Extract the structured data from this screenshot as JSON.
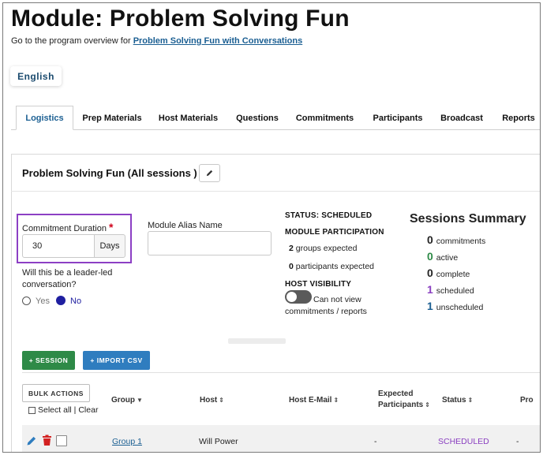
{
  "page": {
    "title": "Module: Problem Solving Fun",
    "overview_prefix": "Go to the program overview for ",
    "overview_link": "Problem Solving Fun with Conversations"
  },
  "language": {
    "label": "English"
  },
  "tabs": [
    {
      "label": "Logistics",
      "active": true
    },
    {
      "label": "Prep Materials"
    },
    {
      "label": "Host Materials"
    },
    {
      "label": "Questions"
    },
    {
      "label": "Commitments"
    },
    {
      "label": "Participants"
    },
    {
      "label": "Broadcast"
    },
    {
      "label": "Reports"
    }
  ],
  "panel": {
    "title": "Problem Solving Fun (All sessions )",
    "commitment_duration": {
      "label": "Commitment Duration",
      "required_mark": "*",
      "value": "30",
      "unit": "Days"
    },
    "alias": {
      "label": "Module Alias Name",
      "value": ""
    },
    "leader_led": {
      "question": "Will this be a leader-led conversation?",
      "yes_label": "Yes",
      "no_label": "No",
      "selected": "No"
    },
    "status": {
      "heading": "STATUS: SCHEDULED",
      "participation_heading": "MODULE PARTICIPATION",
      "groups_num": "2",
      "groups_text": "groups expected",
      "participants_num": "0",
      "participants_text": "participants expected",
      "host_visibility_heading": "HOST VISIBILITY",
      "host_visibility_text": "Can not view commitments / reports",
      "host_visibility_on": false
    },
    "summary": {
      "title": "Sessions Summary",
      "rows": [
        {
          "num": "0",
          "label": "commitments",
          "color": "#222222"
        },
        {
          "num": "0",
          "label": "active",
          "color": "#2e8a47"
        },
        {
          "num": "0",
          "label": "complete",
          "color": "#222222"
        },
        {
          "num": "1",
          "label": "scheduled",
          "color": "#8a3fc0"
        },
        {
          "num": "1",
          "label": "unscheduled",
          "color": "#1b5f92"
        }
      ]
    }
  },
  "actions": {
    "session_label": "+ SESSION",
    "import_label": "+ IMPORT CSV",
    "bulk_label": "BULK ACTIONS",
    "select_all_label": "Select all",
    "separator": "|",
    "clear_label": "Clear"
  },
  "table": {
    "headers": {
      "group": "Group",
      "host": "Host",
      "host_email": "Host E-Mail",
      "expected_1": "Expected",
      "expected_2": "Participants",
      "status": "Status",
      "pro": "Pro"
    },
    "rows": [
      {
        "group": "Group 1",
        "host": "Will Power",
        "email": "-",
        "status": "SCHEDULED",
        "pro": "-"
      }
    ]
  },
  "colors": {
    "highlight_border": "#8c3fc4",
    "session_button": "#2e8a47",
    "import_button": "#2f7dbf",
    "link": "#1b5f92",
    "delete_icon": "#d32222",
    "edit_icon": "#2f7dbf"
  }
}
